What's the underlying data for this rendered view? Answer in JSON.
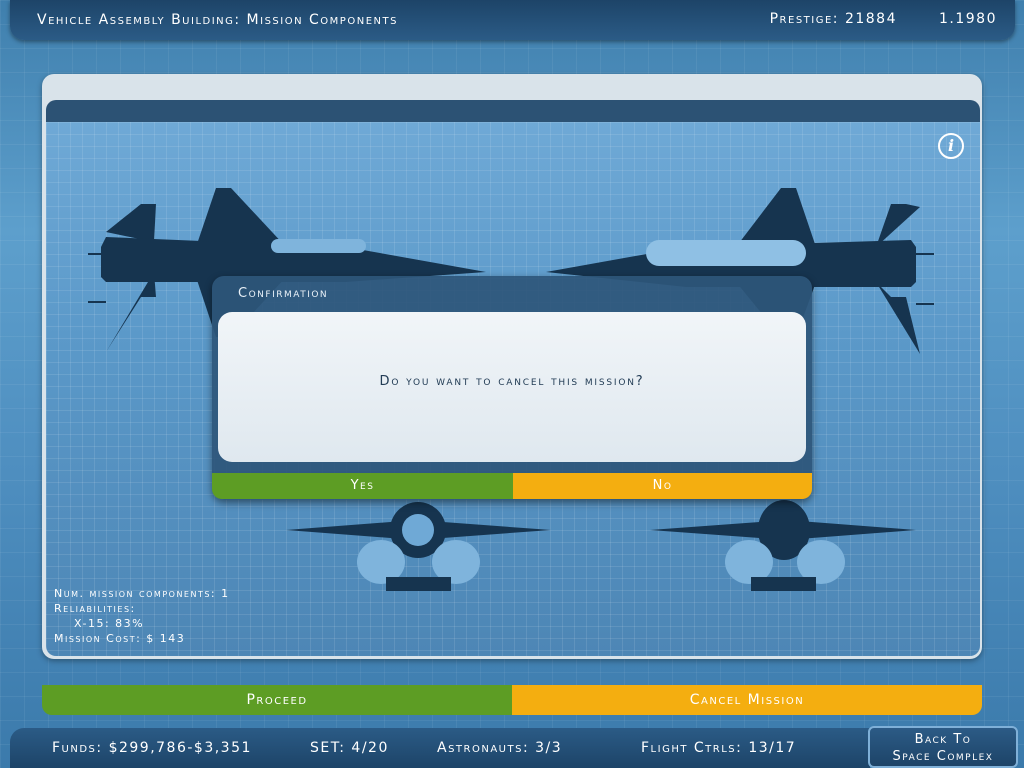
{
  "header": {
    "title": "Vehicle Assembly Building: Mission Components",
    "prestige": "Prestige: 21884",
    "date": "1.1980"
  },
  "info_icon": "info-icon",
  "dialog": {
    "title": "Confirmation",
    "message": "Do you want to cancel this mission?",
    "yes_label": "Yes",
    "no_label": "No"
  },
  "stats": {
    "components": "Num. mission components: 1",
    "reliabilities_label": "Reliabilities:",
    "reliability_item": "X-15: 83%",
    "mission_cost": "Mission Cost: $ 143"
  },
  "actions": {
    "proceed_label": "Proceed",
    "cancel_label": "Cancel Mission"
  },
  "status_bar": {
    "funds": "Funds: $299,786-$3,351",
    "set": "SET: 4/20",
    "astronauts": "Astronauts: 3/3",
    "flight_ctrls": "Flight Ctrls: 13/17"
  },
  "back_button": {
    "line1": "Back To",
    "line2": "Space Complex"
  },
  "colors": {
    "proceed": "#5d9d24",
    "cancel": "#f4ae10",
    "bar": "#1d4468"
  }
}
